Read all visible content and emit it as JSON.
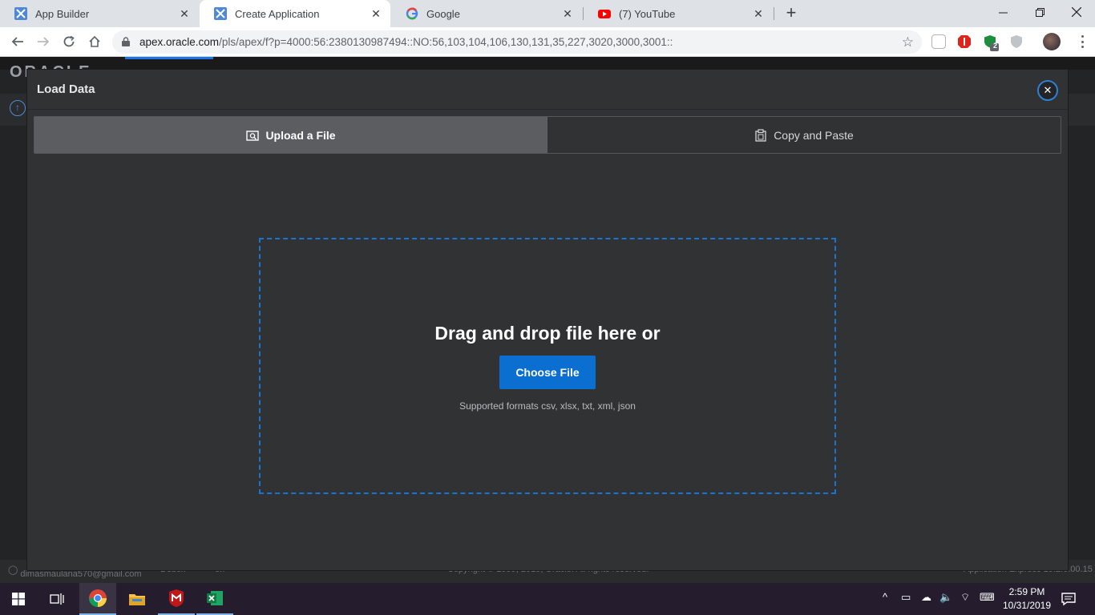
{
  "browser": {
    "tabs": [
      {
        "label": "App Builder",
        "favicon": "apex-icon",
        "active": false
      },
      {
        "label": "Create Application",
        "favicon": "apex-icon",
        "active": true
      },
      {
        "label": "Google",
        "favicon": "google-icon",
        "active": false
      },
      {
        "label": "(7) YouTube",
        "favicon": "youtube-icon",
        "active": false
      }
    ],
    "url_host": "apex.oracle.com",
    "url_path": "/pls/apex/f?p=4000:56:2380130987494::NO:56,103,104,106,130,131,35,227,3020,3000,3001::",
    "extension_badge": "2"
  },
  "apex": {
    "logo": "ORACLE",
    "footer_user": "dimasmaulana570@gmail.com",
    "footer_app": "Debck",
    "footer_lang": "en",
    "footer_copyright": "Copyright © 1999, 2019, Oracle. All rights reserved.",
    "footer_version": "Application Express 19.2.0.00.15"
  },
  "dialog": {
    "title": "Load Data",
    "tabs": [
      {
        "label": "Upload a File",
        "icon": "upload-file-icon",
        "active": true
      },
      {
        "label": "Copy and Paste",
        "icon": "clipboard-icon",
        "active": false
      }
    ],
    "dropzone_title": "Drag and drop file here or",
    "choose_button": "Choose File",
    "supported_formats": "Supported formats csv, xlsx, txt, xml, json"
  },
  "taskbar": {
    "time": "2:59 PM",
    "date": "10/31/2019"
  },
  "colors": {
    "accent": "#0a6fd1",
    "dialog_bg": "#313234",
    "dropzone_border": "#1a74d4"
  }
}
